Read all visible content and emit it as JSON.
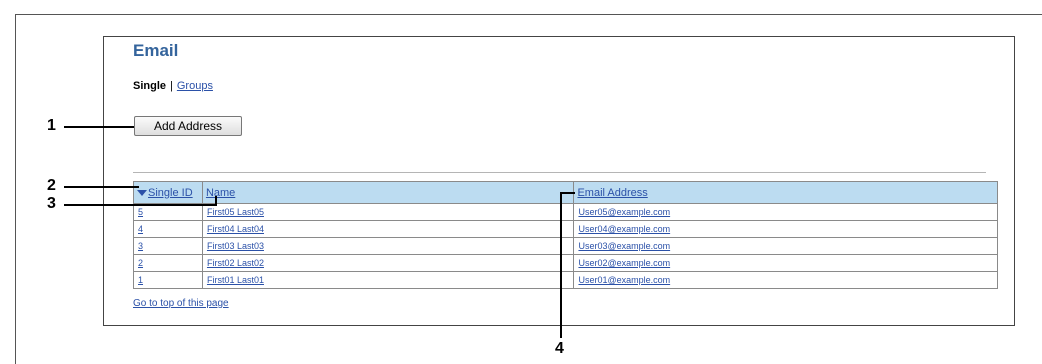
{
  "page": {
    "title": "Email",
    "tabs": {
      "active": "Single",
      "separator": "|",
      "other": "Groups"
    },
    "add_button_label": "Add Address",
    "top_link": "Go to top of this page"
  },
  "table": {
    "headers": {
      "single_id": "Single ID",
      "name": "Name",
      "email": "Email Address"
    },
    "sort": "descending",
    "rows": [
      {
        "id": "5",
        "name": "First05 Last05",
        "email": "User05@example.com"
      },
      {
        "id": "4",
        "name": "First04 Last04",
        "email": "User04@example.com"
      },
      {
        "id": "3",
        "name": "First03 Last03",
        "email": "User03@example.com"
      },
      {
        "id": "2",
        "name": "First02 Last02",
        "email": "User02@example.com"
      },
      {
        "id": "1",
        "name": "First01 Last01",
        "email": "User01@example.com"
      }
    ]
  },
  "callouts": [
    "1",
    "2",
    "3",
    "4"
  ],
  "colors": {
    "title": "#34649c",
    "link": "#2b51a8",
    "header_bg": "#bcdcf1"
  }
}
